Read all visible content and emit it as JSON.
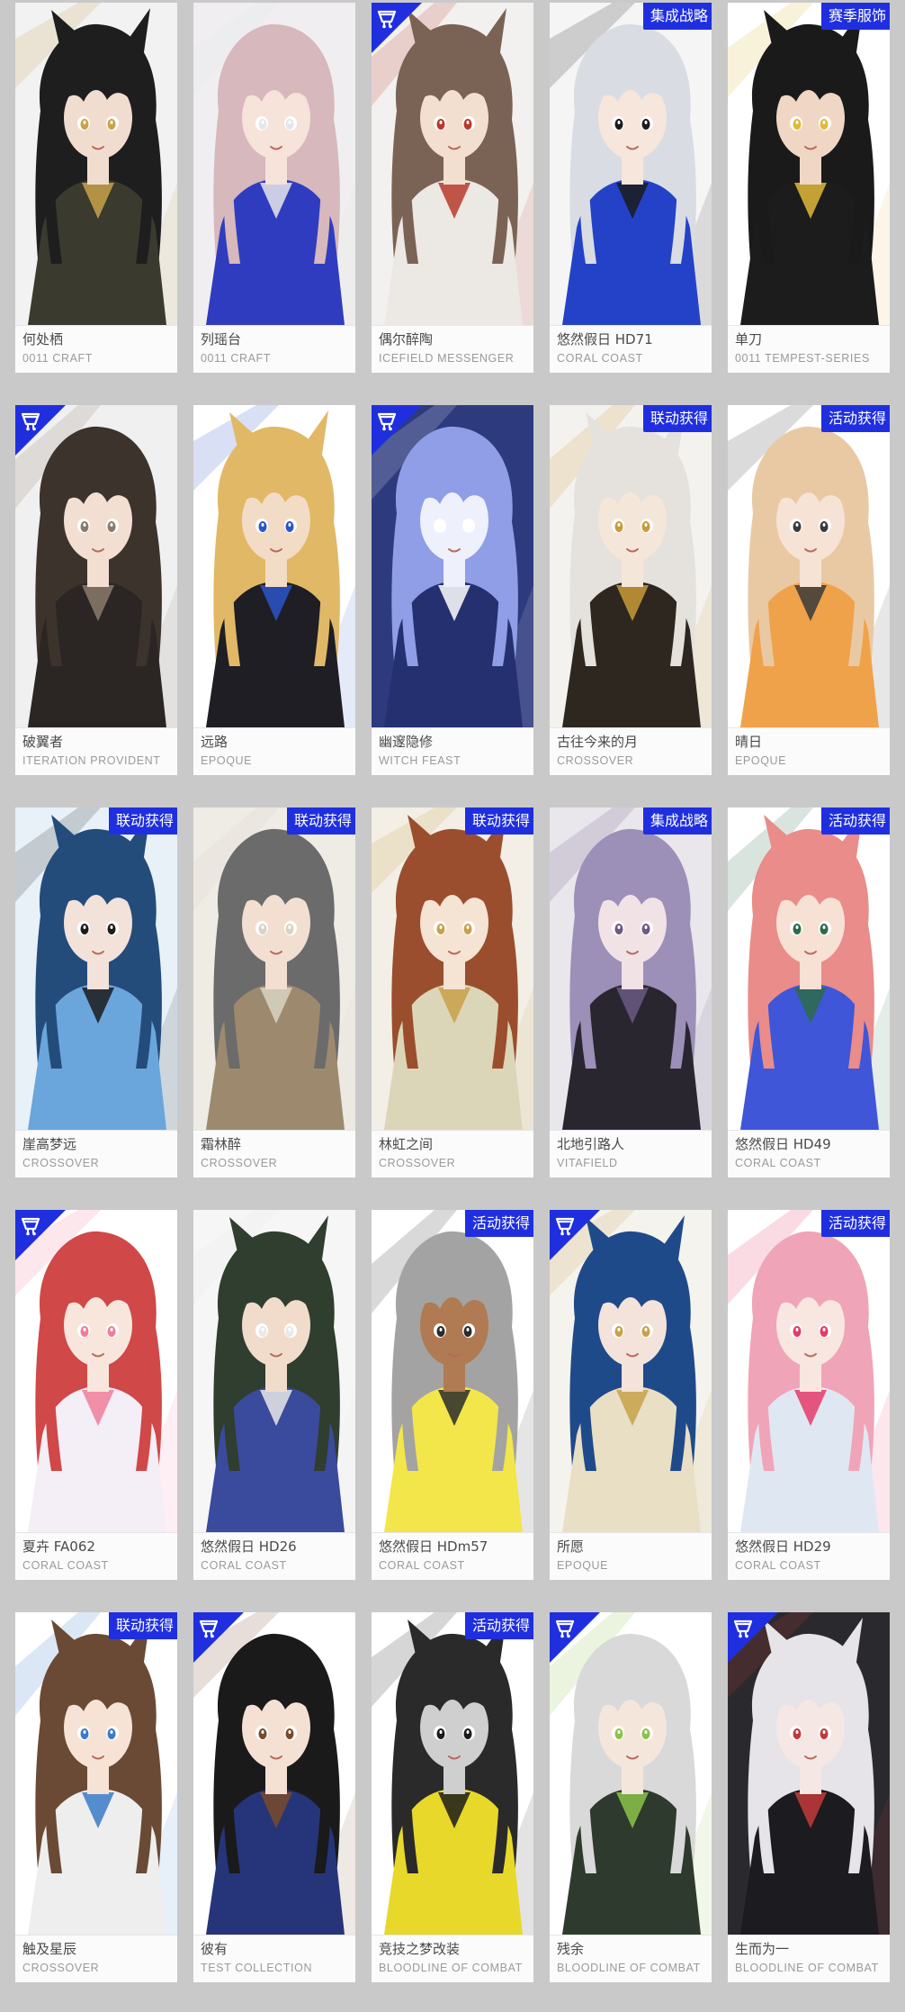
{
  "cards": [
    {
      "name": "何处栖",
      "series": "0011 CRAFT",
      "tag": "",
      "corner": false,
      "palette": {
        "bg": "#f2f2f2",
        "hair": "#1e1e1e",
        "skin": "#f1ddd0",
        "outfit": "#3a3a2e",
        "accent": "#c9a24a"
      }
    },
    {
      "name": "列瑶台",
      "series": "0011 CRAFT",
      "tag": "",
      "corner": false,
      "palette": {
        "bg": "#f0eef0",
        "hair": "#d7b8bc",
        "skin": "#f6e3da",
        "outfit": "#2f3cc0",
        "accent": "#e6e6ea"
      }
    },
    {
      "name": "偶尔醉陶",
      "series": "ICEFIELD MESSENGER",
      "tag": "",
      "corner": true,
      "palette": {
        "bg": "#f3f1ef",
        "hair": "#7a6355",
        "skin": "#f3dfcf",
        "outfit": "#ece8e4",
        "accent": "#b93a2a"
      }
    },
    {
      "name": "悠然假日 HD71",
      "series": "CORAL COAST",
      "tag": "集成战略",
      "corner": false,
      "palette": {
        "bg": "#f5f5f5",
        "hair": "#d9dde3",
        "skin": "#f6e6dc",
        "outfit": "#2442c8",
        "accent": "#1b1b1b"
      }
    },
    {
      "name": "单刀",
      "series": "0011 TEMPEST-SERIES",
      "tag": "赛季服饰",
      "corner": false,
      "palette": {
        "bg": "#ffffff",
        "hair": "#1a1a1a",
        "skin": "#f0d6c4",
        "outfit": "#1c1c1c",
        "accent": "#e0b93a"
      }
    },
    {
      "name": "破翼者",
      "series": "ITERATION PROVIDENT",
      "tag": "",
      "corner": true,
      "palette": {
        "bg": "#f0f0f0",
        "hair": "#3b332c",
        "skin": "#f2dfd2",
        "outfit": "#2b2623",
        "accent": "#8a7a6a"
      }
    },
    {
      "name": "远路",
      "series": "EPOQUE",
      "tag": "",
      "corner": false,
      "palette": {
        "bg": "#ffffff",
        "hair": "#e1b866",
        "skin": "#f3dcc6",
        "outfit": "#1e1e24",
        "accent": "#2a55c8"
      }
    },
    {
      "name": "幽邃隐修",
      "series": "WITCH FEAST",
      "tag": "",
      "corner": true,
      "palette": {
        "bg": "#2d3a7e",
        "hair": "#8f9ee6",
        "skin": "#eef0fb",
        "outfit": "#24306f",
        "accent": "#ffffff"
      }
    },
    {
      "name": "古往今来的月",
      "series": "CROSSOVER",
      "tag": "联动获得",
      "corner": false,
      "palette": {
        "bg": "#f4f2ee",
        "hair": "#e5e2de",
        "skin": "#f5e6da",
        "outfit": "#2d2720",
        "accent": "#c99b3a"
      }
    },
    {
      "name": "晴日",
      "series": "EPOQUE",
      "tag": "活动获得",
      "corner": false,
      "palette": {
        "bg": "#ffffff",
        "hair": "#e9c9a4",
        "skin": "#f6e3d6",
        "outfit": "#f0a24a",
        "accent": "#3a3a3a"
      }
    },
    {
      "name": "崖高梦远",
      "series": "CROSSOVER",
      "tag": "联动获得",
      "corner": false,
      "palette": {
        "bg": "#e8f1f8",
        "hair": "#244c7a",
        "skin": "#f3e2da",
        "outfit": "#6aa6dc",
        "accent": "#1b1b1b"
      }
    },
    {
      "name": "霜林醉",
      "series": "CROSSOVER",
      "tag": "联动获得",
      "corner": false,
      "palette": {
        "bg": "#efece6",
        "hair": "#6b6b6b",
        "skin": "#f2dfd2",
        "outfit": "#9d8a6e",
        "accent": "#d9d3c6"
      }
    },
    {
      "name": "林虹之间",
      "series": "CROSSOVER",
      "tag": "联动获得",
      "corner": false,
      "palette": {
        "bg": "#f3efe6",
        "hair": "#9a4e2e",
        "skin": "#f5e3d4",
        "outfit": "#dcd6b8",
        "accent": "#c9a04a"
      }
    },
    {
      "name": "北地引路人",
      "series": "VITAFIELD",
      "tag": "集成战略",
      "corner": false,
      "palette": {
        "bg": "#e9e6ec",
        "hair": "#9c8fb8",
        "skin": "#f1e2e6",
        "outfit": "#2a2630",
        "accent": "#6a5a84"
      }
    },
    {
      "name": "悠然假日 HD49",
      "series": "CORAL COAST",
      "tag": "活动获得",
      "corner": false,
      "palette": {
        "bg": "#ffffff",
        "hair": "#e98c8a",
        "skin": "#f7e1d4",
        "outfit": "#3f56d8",
        "accent": "#2c6b4a"
      }
    },
    {
      "name": "夏卉 FA062",
      "series": "CORAL COAST",
      "tag": "",
      "corner": true,
      "palette": {
        "bg": "#ffffff",
        "hair": "#d04848",
        "skin": "#f8e6dc",
        "outfit": "#f4eef6",
        "accent": "#f07c9a"
      }
    },
    {
      "name": "悠然假日 HD26",
      "series": "CORAL COAST",
      "tag": "",
      "corner": false,
      "palette": {
        "bg": "#f6f6f6",
        "hair": "#2f3e2e",
        "skin": "#f1dccb",
        "outfit": "#3a4a9c",
        "accent": "#e9e9e9"
      }
    },
    {
      "name": "悠然假日 HDm57",
      "series": "CORAL COAST",
      "tag": "活动获得",
      "corner": false,
      "palette": {
        "bg": "#ffffff",
        "hair": "#a3a3a3",
        "skin": "#b07a52",
        "outfit": "#f2e64a",
        "accent": "#2a2a2a"
      }
    },
    {
      "name": "所愿",
      "series": "EPOQUE",
      "tag": "",
      "corner": true,
      "palette": {
        "bg": "#f5f3ee",
        "hair": "#1f4a8a",
        "skin": "#f3e3da",
        "outfit": "#e9dfc4",
        "accent": "#c8a24a"
      }
    },
    {
      "name": "悠然假日 HD29",
      "series": "CORAL COAST",
      "tag": "活动获得",
      "corner": false,
      "palette": {
        "bg": "#ffffff",
        "hair": "#f0a4b8",
        "skin": "#f8e6e0",
        "outfit": "#dfe8f2",
        "accent": "#e63a6a"
      }
    },
    {
      "name": "触及星辰",
      "series": "CROSSOVER",
      "tag": "联动获得",
      "corner": false,
      "palette": {
        "bg": "#ffffff",
        "hair": "#6a4a34",
        "skin": "#f6e3d6",
        "outfit": "#eeeeee",
        "accent": "#3a7ac8"
      }
    },
    {
      "name": "彼有",
      "series": "TEST COLLECTION",
      "tag": "",
      "corner": true,
      "palette": {
        "bg": "#ffffff",
        "hair": "#1a1a1a",
        "skin": "#f4e1d4",
        "outfit": "#26357a",
        "accent": "#7a4a2a"
      }
    },
    {
      "name": "竞技之梦改装",
      "series": "BLOODLINE OF COMBAT",
      "tag": "活动获得",
      "corner": false,
      "palette": {
        "bg": "#ffffff",
        "hair": "#2a2a2a",
        "skin": "#cfcfcf",
        "outfit": "#e8d82a",
        "accent": "#1b1b1b"
      }
    },
    {
      "name": "残余",
      "series": "BLOODLINE OF COMBAT",
      "tag": "",
      "corner": true,
      "palette": {
        "bg": "#ffffff",
        "hair": "#d9d9d9",
        "skin": "#f5e6dc",
        "outfit": "#2f3a2e",
        "accent": "#8bc34a"
      }
    },
    {
      "name": "生而为一",
      "series": "BLOODLINE OF COMBAT",
      "tag": "",
      "corner": true,
      "palette": {
        "bg": "#2a2a2e",
        "hair": "#e6e4e8",
        "skin": "#f5e8e4",
        "outfit": "#1b1b20",
        "accent": "#c23a3a"
      }
    }
  ]
}
